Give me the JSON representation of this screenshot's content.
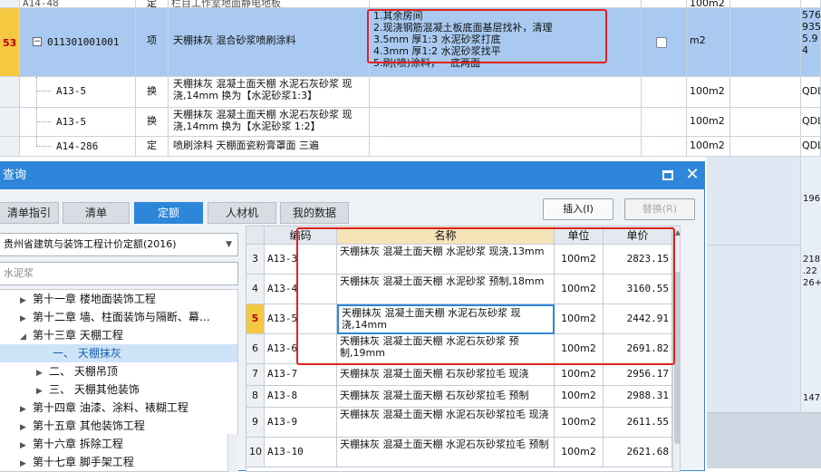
{
  "main_grid": {
    "top_row": {
      "code": "A14-48",
      "type": "定",
      "name": "栏目工作室地面静电地板",
      "unit": "100m2"
    },
    "row53": {
      "index": "53",
      "code": "011301001001",
      "type": "项",
      "name": "天棚抹灰 混合砂浆喷刷涂料",
      "features": [
        "1.其余房间",
        "2.现浇钢筋混凝土板底面基层找补，清理",
        "3.5mm 厚1:3 水泥砂浆打底",
        "4.3mm 厚1:2 水泥砂浆找平",
        "5.刷(喷)涂料，一底两面"
      ],
      "unit": "m2",
      "extra": [
        "576",
        "935",
        "5.9",
        "4"
      ]
    },
    "sub_rows": [
      {
        "code": "A13-5",
        "type": "换",
        "name": "天棚抹灰 混凝土面天棚 水泥石灰砂浆 现浇,14mm  换为【水泥砂浆1:3】",
        "unit": "100m2",
        "extra": "QDL"
      },
      {
        "code": "A13-5",
        "type": "换",
        "name": "天棚抹灰 混凝土面天棚 水泥石灰砂浆 现浇,14mm  换为【水泥砂浆 1:2】",
        "unit": "100m2",
        "extra": "QDL"
      },
      {
        "code": "A14-286",
        "type": "定",
        "name": "喷刷涂料 天棚面瓷粉膏罩面 三遍",
        "unit": "100m2",
        "extra": "QDL"
      }
    ],
    "right_values": [
      "196",
      "218",
      ".22",
      "26+",
      "147"
    ]
  },
  "dialog": {
    "title": "查询",
    "tabs": [
      {
        "label": "清单指引",
        "active": false
      },
      {
        "label": "清单",
        "active": false
      },
      {
        "label": "定额",
        "active": true
      },
      {
        "label": "人材机",
        "active": false
      },
      {
        "label": "我的数据",
        "active": false
      }
    ],
    "insert_button": "插入(I)",
    "replace_button": "替换(R)",
    "quota_select": "贵州省建筑与装饰工程计价定额(2016)",
    "search_value": "水泥浆",
    "tree": [
      {
        "label": "第十一章 楼地面装饰工程",
        "level": 1,
        "expanded": false,
        "selected": false
      },
      {
        "label": "第十二章 墙、柱面装饰与隔断、幕…",
        "level": 1,
        "expanded": false,
        "selected": false
      },
      {
        "label": "第十三章 天棚工程",
        "level": 1,
        "expanded": true,
        "selected": false
      },
      {
        "label": "一、 天棚抹灰",
        "level": 2,
        "expanded": false,
        "selected": true
      },
      {
        "label": "二、 天棚吊顶",
        "level": 2,
        "expanded": false,
        "selected": false
      },
      {
        "label": "三、 天棚其他装饰",
        "level": 2,
        "expanded": false,
        "selected": false
      },
      {
        "label": "第十四章 油漆、涂料、裱糊工程",
        "level": 1,
        "expanded": false,
        "selected": false
      },
      {
        "label": "第十五章 其他装饰工程",
        "level": 1,
        "expanded": false,
        "selected": false
      },
      {
        "label": "第十六章 拆除工程",
        "level": 1,
        "expanded": false,
        "selected": false
      },
      {
        "label": "第十七章 脚手架工程",
        "level": 1,
        "expanded": false,
        "selected": false
      }
    ],
    "grid_headers": {
      "code": "编码",
      "name": "名称",
      "unit": "单位",
      "price": "单价"
    },
    "rows": [
      {
        "n": "3",
        "code": "A13-3",
        "name": "天棚抹灰 混凝土面天棚 水泥砂浆 现浇,13mm",
        "unit": "100m2",
        "price": "2823.15"
      },
      {
        "n": "4",
        "code": "A13-4",
        "name": "天棚抹灰 混凝土面天棚 水泥砂浆 预制,18mm",
        "unit": "100m2",
        "price": "3160.55"
      },
      {
        "n": "5",
        "code": "A13-5",
        "name": "天棚抹灰 混凝土面天棚 水泥石灰砂浆 现浇,14mm",
        "unit": "100m2",
        "price": "2442.91"
      },
      {
        "n": "6",
        "code": "A13-6",
        "name": "天棚抹灰 混凝土面天棚 水泥石灰砂浆 预制,19mm",
        "unit": "100m2",
        "price": "2691.82"
      },
      {
        "n": "7",
        "code": "A13-7",
        "name": "天棚抹灰 混凝土面天棚 石灰砂浆拉毛 现浇",
        "unit": "100m2",
        "price": "2956.17"
      },
      {
        "n": "8",
        "code": "A13-8",
        "name": "天棚抹灰 混凝土面天棚 石灰砂浆拉毛 预制",
        "unit": "100m2",
        "price": "2988.31"
      },
      {
        "n": "9",
        "code": "A13-9",
        "name": "天棚抹灰 混凝土面天棚 水泥石灰砂浆拉毛 现浇",
        "unit": "100m2",
        "price": "2611.55"
      },
      {
        "n": "10",
        "code": "A13-10",
        "name": "天棚抹灰 混凝土面天棚 水泥石灰砂浆拉毛 预制",
        "unit": "100m2",
        "price": "2621.68"
      }
    ],
    "selected_row_n": "5"
  },
  "colors": {
    "titlebar": "#2d86d9",
    "selection": "#a9c9f0",
    "highlight_box": "#e0231e",
    "row_number_53": "#f5c842"
  }
}
